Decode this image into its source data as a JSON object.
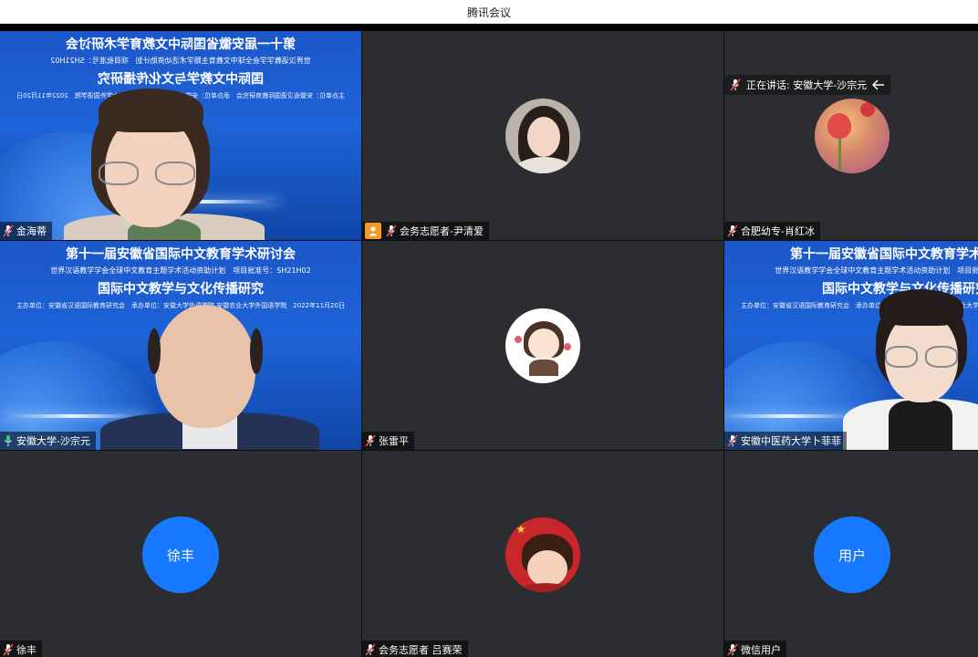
{
  "window": {
    "title": "腾讯会议"
  },
  "speaking": {
    "text": "正在讲话: 安徽大学-沙宗元"
  },
  "tiles": [
    {
      "name": "金海蒂"
    },
    {
      "name": "会务志愿者-尹清爱"
    },
    {
      "name": "合肥幼专-肖红冰"
    },
    {
      "name": "安徽大学-沙宗元"
    },
    {
      "name": "张雷平"
    },
    {
      "name": "安徽中医药大学卜菲菲"
    },
    {
      "name": "徐丰",
      "avatar_text": "徐丰"
    },
    {
      "name": "会务志愿者 吕赛荣"
    },
    {
      "name": "微信用户",
      "avatar_text": "用户"
    }
  ],
  "banner": {
    "title": "第十一届安徽省国际中文教育学术研讨会",
    "sub1": "世界汉语教学学会全球中文教育主题学术活动资助计划",
    "project": "项目批准号：SH21H02",
    "topic": "国际中文教学与文化传播研究",
    "organizers": "主办单位：安徽省汉语国际教育研究会　承办单位：安徽大学外语学院 安徽农业大学外国语学院",
    "date": "2022年11月20日"
  },
  "colors": {
    "accent": "#1677ff",
    "active_border": "#2fd07a",
    "tile_bg": "#2b2d30",
    "host_badge": "#f59a23"
  }
}
